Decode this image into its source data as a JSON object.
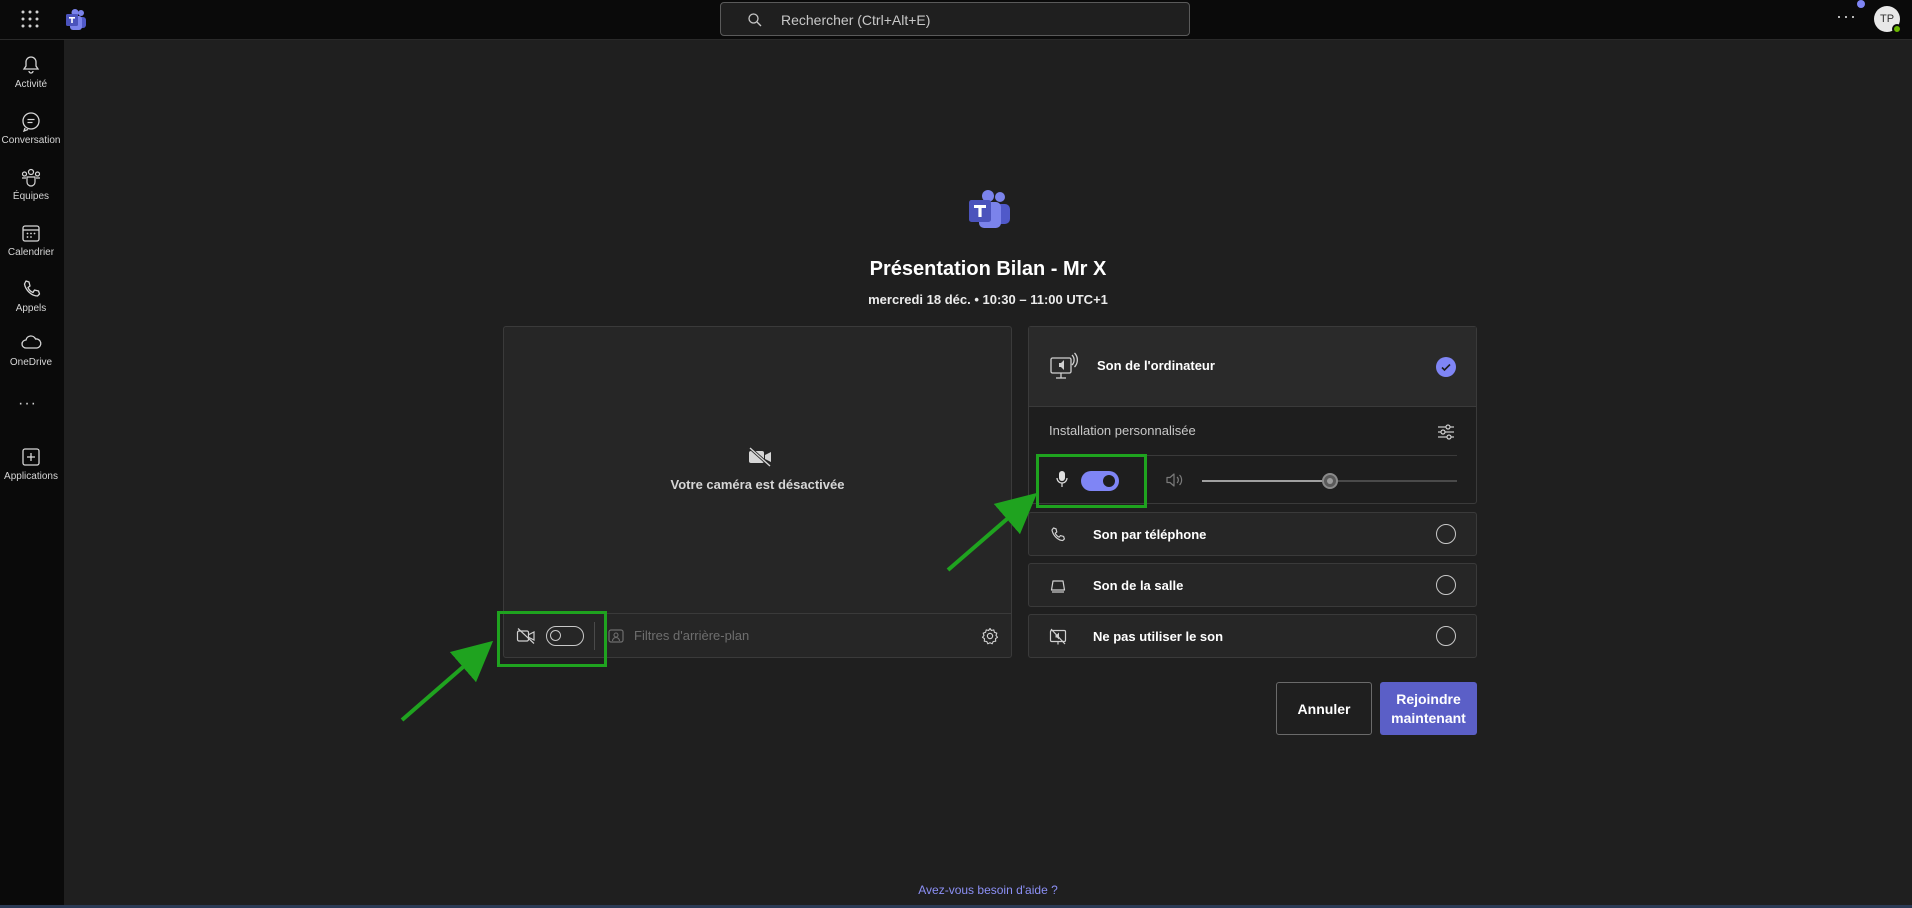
{
  "topbar": {
    "search_placeholder": "Rechercher (Ctrl+Alt+E)",
    "more_label": "···",
    "avatar_initials": "TP"
  },
  "rail": {
    "items": [
      {
        "label": "Activité",
        "icon": "bell-icon"
      },
      {
        "label": "Conversation",
        "icon": "chat-icon"
      },
      {
        "label": "Équipes",
        "icon": "teams-icon"
      },
      {
        "label": "Calendrier",
        "icon": "calendar-icon"
      },
      {
        "label": "Appels",
        "icon": "phone-icon"
      },
      {
        "label": "OneDrive",
        "icon": "cloud-icon"
      },
      {
        "label": "Applications",
        "icon": "add-apps-icon"
      }
    ],
    "more_label": "···"
  },
  "meeting": {
    "title": "Présentation Bilan - Mr X",
    "time": "mercredi 18 déc. • 10:30 – 11:00 UTC+1"
  },
  "video": {
    "camera_off_text": "Votre caméra est désactivée",
    "camera_enabled": false,
    "background_filters_label": "Filtres d'arrière-plan"
  },
  "audio": {
    "selected": {
      "label": "Son de l'ordinateur",
      "custom_setup_label": "Installation personnalisée",
      "mic_enabled": true,
      "speaker_volume_fraction": 0.5
    },
    "options": [
      {
        "label": "Son par téléphone",
        "icon": "phone-icon"
      },
      {
        "label": "Son de la salle",
        "icon": "room-icon"
      },
      {
        "label": "Ne pas utiliser le son",
        "icon": "no-audio-icon"
      }
    ]
  },
  "buttons": {
    "cancel": "Annuler",
    "join": "Rejoindre maintenant"
  },
  "help_link": "Avez-vous besoin d'aide ?",
  "colors": {
    "accent": "#7f85f5",
    "join_button": "#5b5fc7",
    "annotation": "#1fa31f",
    "background": "#1f1f1f"
  }
}
